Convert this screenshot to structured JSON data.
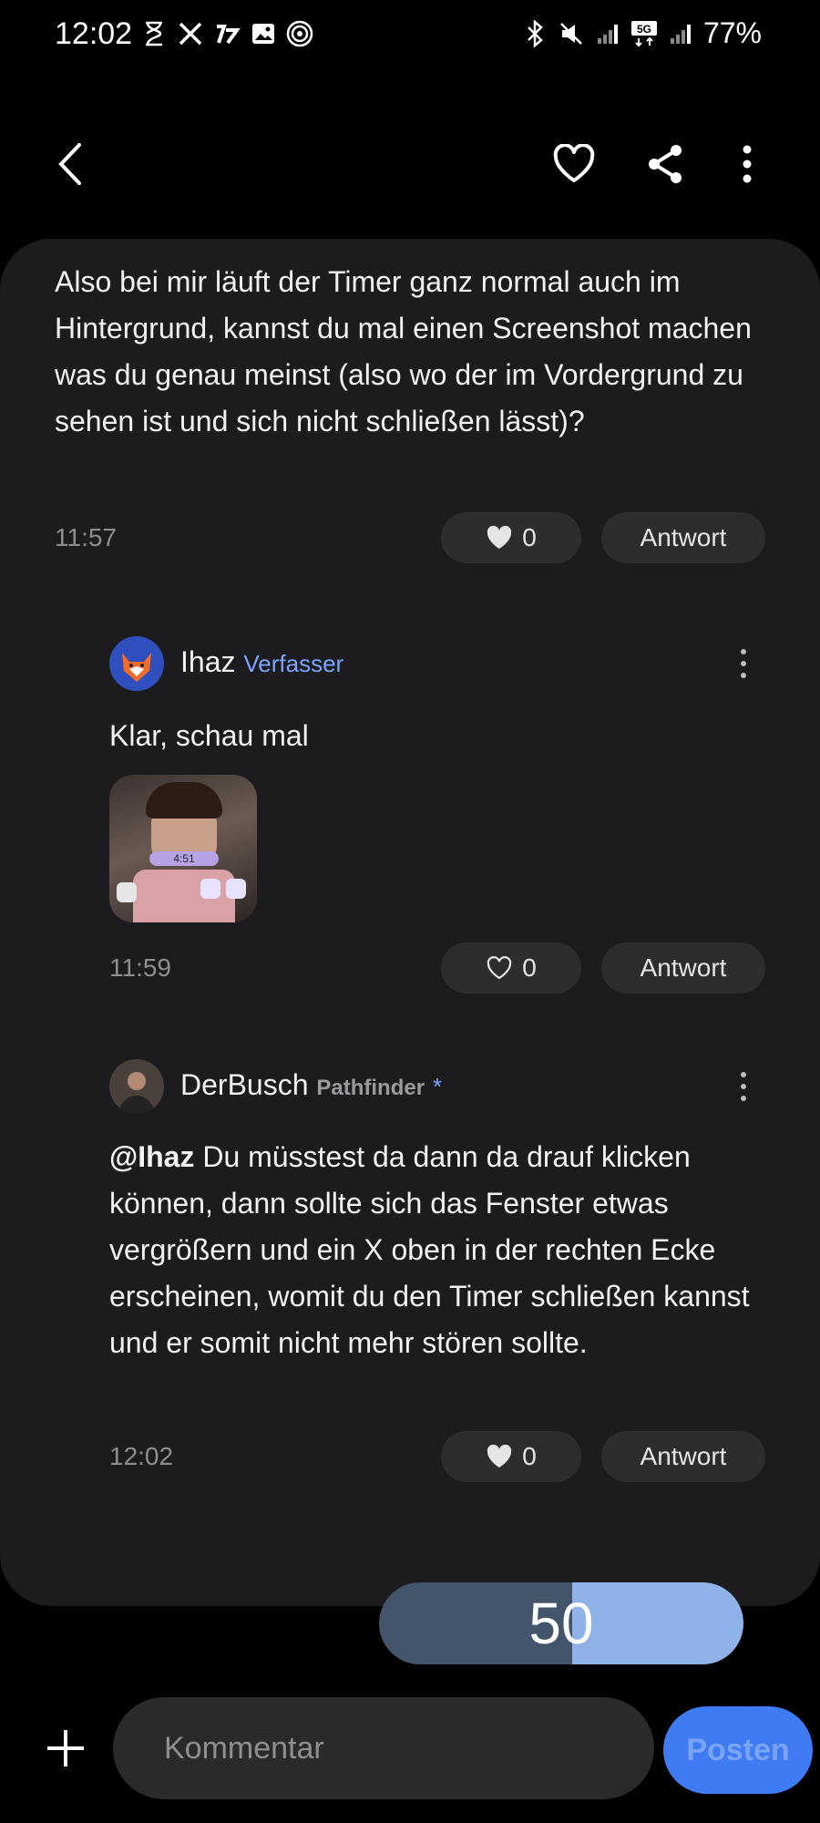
{
  "status_bar": {
    "time": "12:02",
    "battery": "77%",
    "left_icons": [
      "hourglass-icon",
      "x-app-icon",
      "news-icon",
      "image-icon",
      "hotspot-icon"
    ],
    "right_icons": [
      "bluetooth-icon",
      "mute-icon",
      "signal-icon",
      "5g-icon",
      "signal-icon"
    ]
  },
  "top_bar": {
    "icons": [
      "back-icon",
      "heart-icon",
      "share-icon",
      "more-icon"
    ]
  },
  "comments": [
    {
      "text": "Also bei mir läuft der Timer ganz normal auch im Hintergrund, kannst du mal einen Screenshot machen was du genau meinst (also wo der im Vordergrund zu sehen ist und sich nicht schließen lässt)?",
      "time": "11:57",
      "likes": "0",
      "reply_label": "Antwort"
    },
    {
      "author": "Ihaz",
      "badge": "Verfasser",
      "text": "Klar, schau mal",
      "thumb_clock": "4:51",
      "time": "11:59",
      "likes": "0",
      "reply_label": "Antwort"
    },
    {
      "author": "DerBusch",
      "rank": "Pathfinder",
      "rank_mark": "*",
      "mention": "@Ihaz",
      "text": "Du müsstest da dann da drauf klicken können, dann sollte sich das Fenster etwas vergrößern und ein X oben in der rechten Ecke erscheinen, womit du den Timer schließen kannst und er somit nicht mehr stören sollte.",
      "time": "12:02",
      "likes": "0",
      "reply_label": "Antwort"
    }
  ],
  "slider": {
    "value": "50",
    "fill_fraction": 0.47
  },
  "composer": {
    "placeholder": "Kommentar",
    "post_label": "Posten"
  },
  "colors": {
    "accent": "#3f7cf4",
    "author_badge": "#7aa5ff",
    "card_bg": "#1c1c1e"
  }
}
